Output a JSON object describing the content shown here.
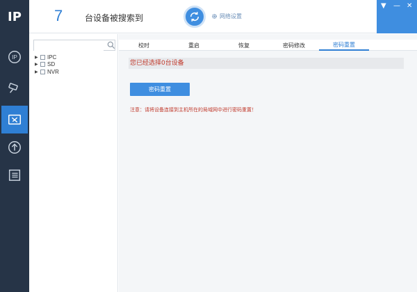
{
  "app": {
    "logo_text": "IP",
    "colors": {
      "sidebar": "#263447",
      "accent": "#2f7fd4",
      "warning": "#c0392b"
    }
  },
  "sidebar": {
    "items": [
      {
        "icon": "ip-icon",
        "active": false
      },
      {
        "icon": "camera-icon",
        "active": false
      },
      {
        "icon": "tools-icon",
        "active": true
      },
      {
        "icon": "upload-icon",
        "active": false
      },
      {
        "icon": "list-icon",
        "active": false
      }
    ]
  },
  "header": {
    "device_count": "7",
    "found_label": "台设备被搜索到",
    "refresh_icon": "refresh-icon",
    "network_settings_label": "网络设置",
    "window_controls": {
      "menu": "▼",
      "minimize": "—",
      "close": "✕"
    }
  },
  "tree": {
    "search_placeholder": "",
    "items": [
      {
        "label": "IPC"
      },
      {
        "label": "SD"
      },
      {
        "label": "NVR"
      }
    ]
  },
  "main": {
    "tabs": [
      {
        "label": "校时",
        "active": false
      },
      {
        "label": "重启",
        "active": false
      },
      {
        "label": "恢复",
        "active": false
      },
      {
        "label": "密码修改",
        "active": false
      },
      {
        "label": "密码重置",
        "active": true
      }
    ],
    "selected_text": "您已经选择0台设备",
    "action_button": "密码重置",
    "note": "注意：请将设备连接到主机所在的局域网中进行密码重置！"
  }
}
